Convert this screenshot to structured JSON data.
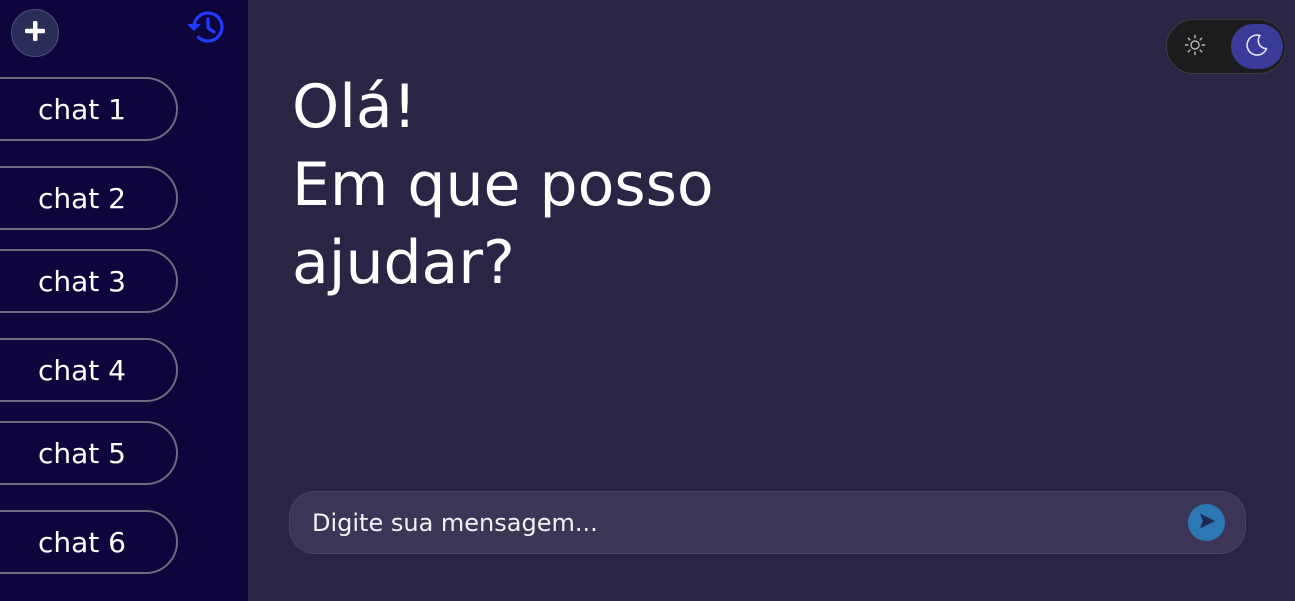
{
  "sidebar": {
    "new_chat_icon": "plus-icon",
    "history_icon": "history-icon",
    "chats": [
      {
        "label": "chat 1"
      },
      {
        "label": "chat 2"
      },
      {
        "label": "chat 3"
      },
      {
        "label": "chat 4"
      },
      {
        "label": "chat 5"
      },
      {
        "label": "chat 6"
      }
    ]
  },
  "main": {
    "greeting_lines": [
      "Olá!",
      "Em que posso",
      "ajudar?"
    ]
  },
  "theme_toggle": {
    "options": [
      "light",
      "dark"
    ],
    "selected": "dark",
    "light_icon": "sun-icon",
    "dark_icon": "moon-icon"
  },
  "composer": {
    "placeholder": "Digite sua mensagem...",
    "value": "",
    "send_icon": "send-icon"
  },
  "colors": {
    "sidebar_bg": "#0e053d",
    "main_bg": "#2a2445",
    "history_icon": "#1f3bff",
    "send_button": "#2b78b5",
    "toggle_active": "#3a3a9a"
  }
}
